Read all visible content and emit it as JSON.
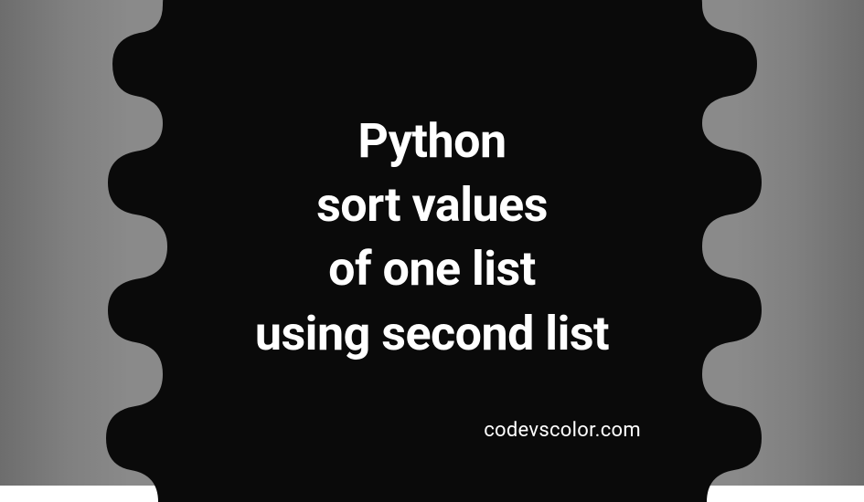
{
  "title": {
    "line1": "Python",
    "line2": "sort values",
    "line3": "of one list",
    "line4": "using second list"
  },
  "watermark": "codevscolor.com",
  "colors": {
    "blob": "#0a0a0a",
    "text": "#ffffff",
    "bg_gray": "#8a8a8a"
  }
}
